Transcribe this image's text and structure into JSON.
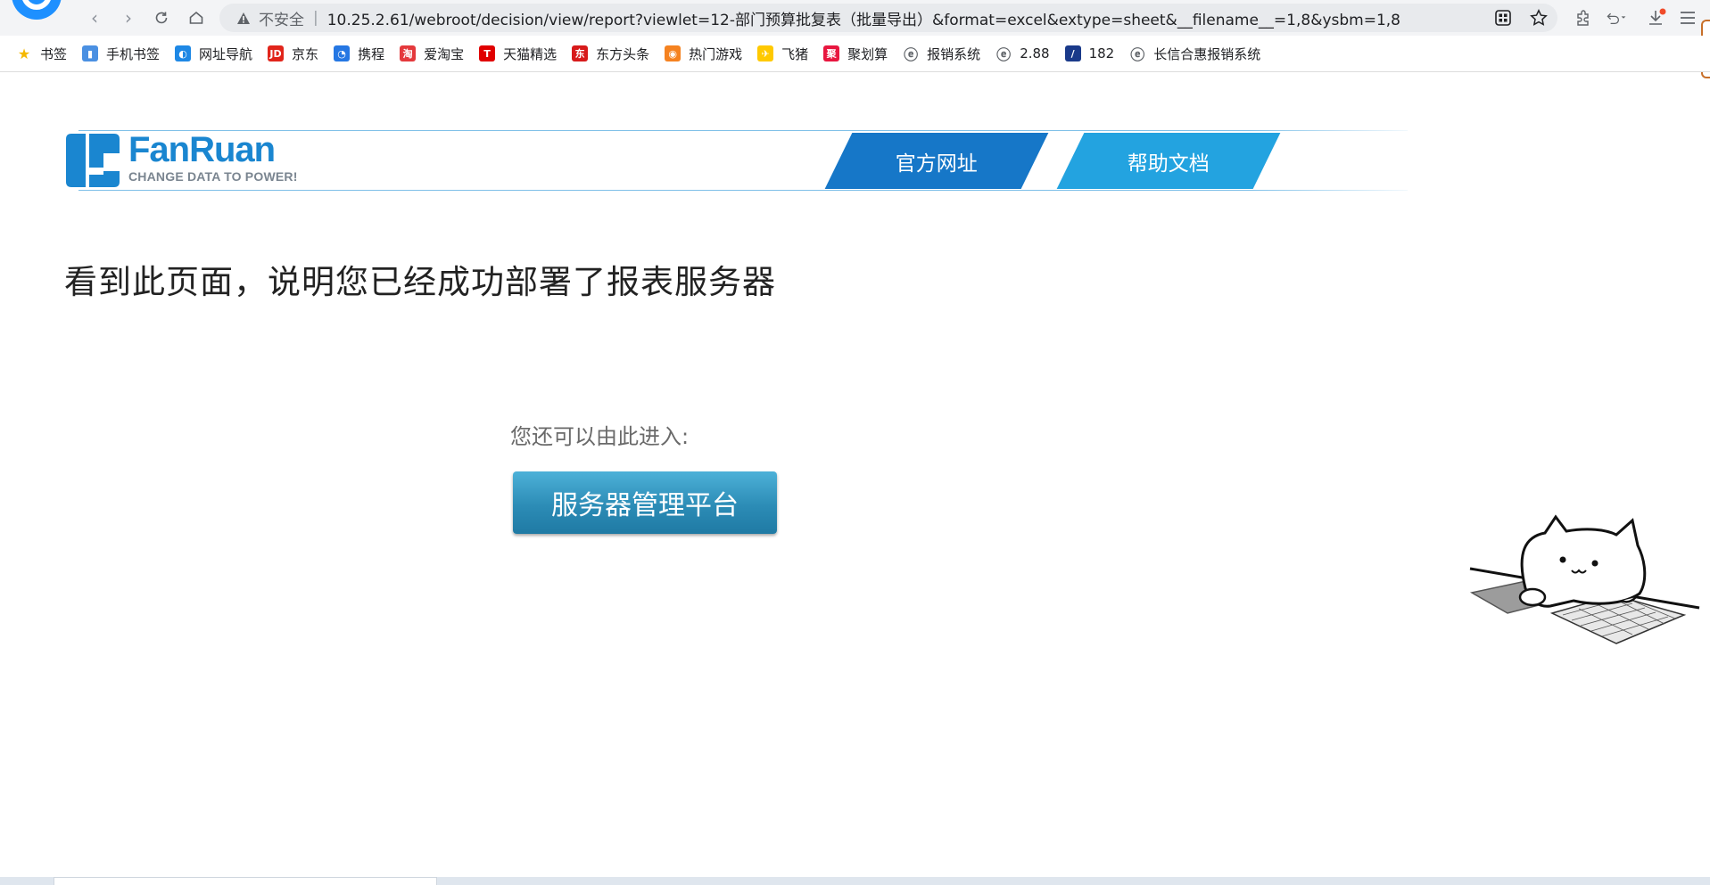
{
  "browser": {
    "insecure_label": "不安全",
    "url": "10.25.2.61/webroot/decision/view/report?viewlet=12-部门预算批复表（批量导出）&format=excel&extype=sheet&__filename__=1,8&ysbm=1,8"
  },
  "bookmarks": [
    {
      "label": "书签",
      "icon": "star-icon",
      "color": "#f5b800"
    },
    {
      "label": "手机书签",
      "icon": "phone-icon",
      "color": "#4a90e2"
    },
    {
      "label": "网址导航",
      "icon": "nav-icon",
      "color": "#1e88e5"
    },
    {
      "label": "京东",
      "icon": "jd-icon",
      "color": "#e1251b"
    },
    {
      "label": "携程",
      "icon": "ctrip-icon",
      "color": "#2577e3"
    },
    {
      "label": "爱淘宝",
      "icon": "taobao-icon",
      "color": "#e4393c"
    },
    {
      "label": "天猫精选",
      "icon": "tmall-icon",
      "color": "#e00000"
    },
    {
      "label": "东方头条",
      "icon": "toutiao-icon",
      "color": "#d71a1b"
    },
    {
      "label": "热门游戏",
      "icon": "game-icon",
      "color": "#f58220"
    },
    {
      "label": "飞猪",
      "icon": "fliggy-icon",
      "color": "#ffc900"
    },
    {
      "label": "聚划算",
      "icon": "juhuasuan-icon",
      "color": "#e8163f"
    },
    {
      "label": "报销系统",
      "icon": "globe-icon",
      "color": "#5f6368"
    },
    {
      "label": "2.88",
      "icon": "globe-icon",
      "color": "#5f6368"
    },
    {
      "label": "182",
      "icon": "slash-icon",
      "color": "#1a3a8a"
    },
    {
      "label": "长信合惠报销系统",
      "icon": "globe-icon",
      "color": "#5f6368"
    }
  ],
  "header": {
    "logo_name": "FanRuan",
    "logo_tagline": "CHANGE DATA TO POWER!",
    "tab_official": "官方网址",
    "tab_help": "帮助文档",
    "brand_color": "#1a86d0"
  },
  "main": {
    "heading": "看到此页面，说明您已经成功部署了报表服务器",
    "enter_label": "您还可以由此进入:",
    "admin_button": "服务器管理平台"
  }
}
